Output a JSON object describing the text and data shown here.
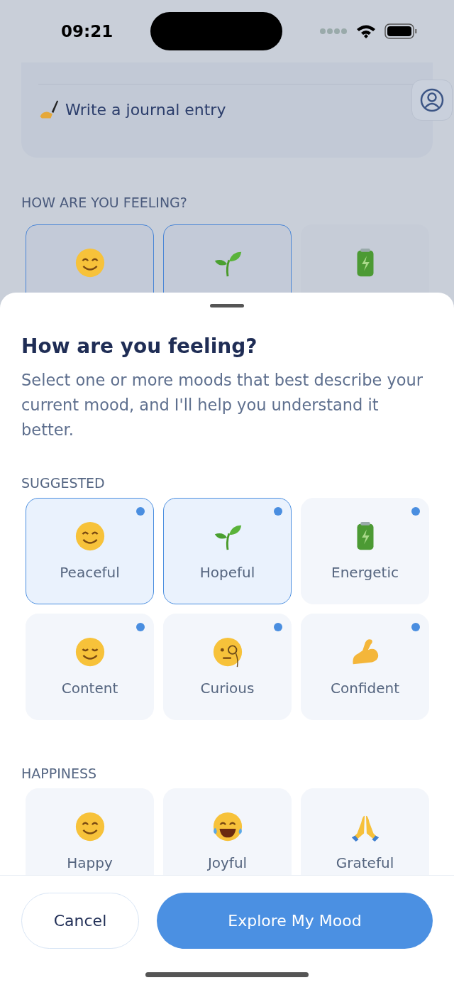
{
  "status_bar": {
    "time": "09:21"
  },
  "background": {
    "actions": [
      {
        "label": "Write a journal entry",
        "kind": "pen"
      }
    ],
    "section_title": "HOW ARE YOU FEELING?",
    "moods": [
      {
        "kind": "smile",
        "selected": true
      },
      {
        "kind": "sprout",
        "selected": true
      },
      {
        "kind": "battery",
        "selected": false
      }
    ]
  },
  "sheet": {
    "title": "How are you feeling?",
    "description": "Select one or more moods that best describe your current mood, and I'll help you understand it better.",
    "sections": [
      {
        "title": "SUGGESTED",
        "moods": [
          {
            "label": "Peaceful",
            "kind": "smile",
            "selected": true,
            "suggested": true
          },
          {
            "label": "Hopeful",
            "kind": "sprout",
            "selected": true,
            "suggested": true
          },
          {
            "label": "Energetic",
            "kind": "battery",
            "selected": false,
            "suggested": true
          },
          {
            "label": "Content",
            "kind": "relieved",
            "selected": false,
            "suggested": true
          },
          {
            "label": "Curious",
            "kind": "monocle",
            "selected": false,
            "suggested": true
          },
          {
            "label": "Confident",
            "kind": "muscle",
            "selected": false,
            "suggested": true
          }
        ]
      },
      {
        "title": "HAPPINESS",
        "moods": [
          {
            "label": "Happy",
            "kind": "smile",
            "selected": false,
            "suggested": false
          },
          {
            "label": "Joyful",
            "kind": "joy",
            "selected": false,
            "suggested": false
          },
          {
            "label": "Grateful",
            "kind": "pray",
            "selected": false,
            "suggested": false
          }
        ]
      }
    ]
  },
  "buttons": [
    {
      "label": "Cancel",
      "kind": "secondary"
    },
    {
      "label": "Explore My Mood",
      "kind": "primary"
    }
  ]
}
